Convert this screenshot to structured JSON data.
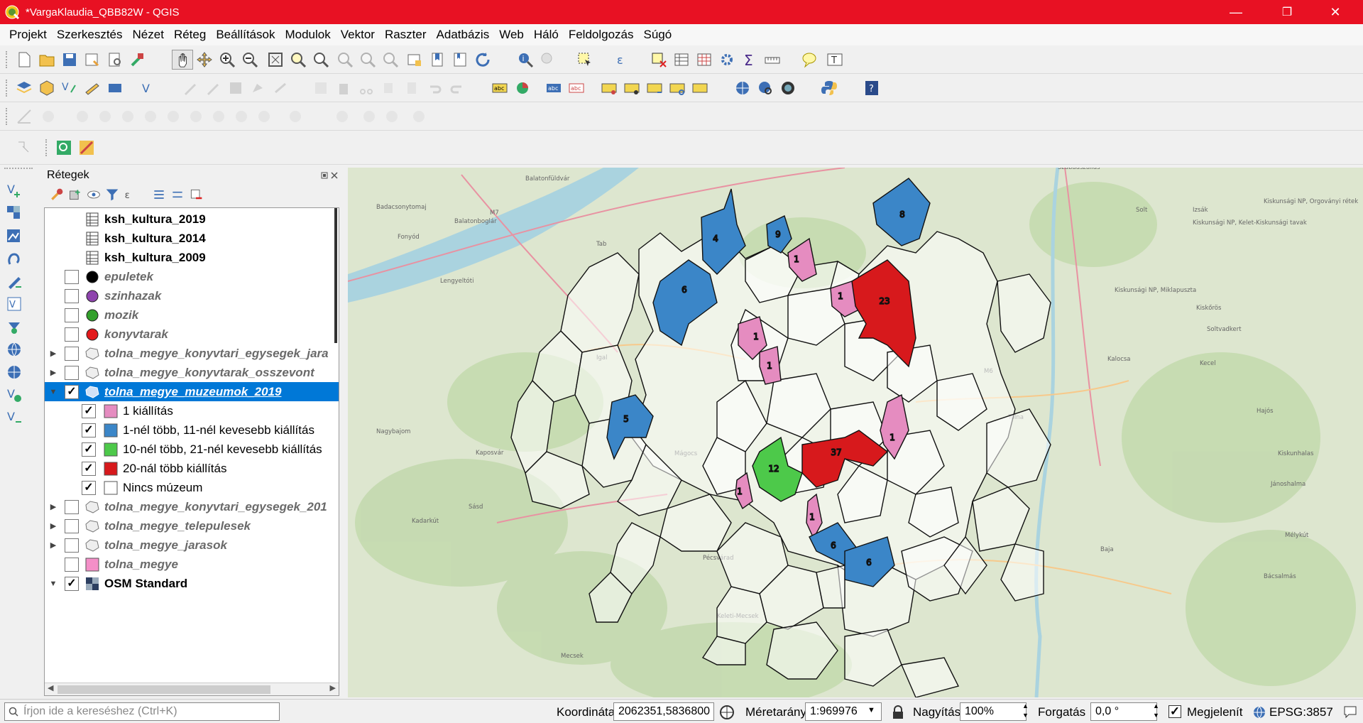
{
  "window": {
    "title": "*VargaKlaudia_QBB82W - QGIS",
    "minimize": "—",
    "maximize": "❐",
    "close": "✕"
  },
  "menu": [
    "Projekt",
    "Szerkesztés",
    "Nézet",
    "Réteg",
    "Beállítások",
    "Modulok",
    "Vektor",
    "Raszter",
    "Adatbázis",
    "Web",
    "Háló",
    "Feldolgozás",
    "Súgó"
  ],
  "layers_panel": {
    "title": "Rétegek",
    "items": [
      {
        "label": "ksh_kultura_2019",
        "type": "table",
        "checked": null,
        "style": "bold"
      },
      {
        "label": "ksh_kultura_2014",
        "type": "table",
        "checked": null,
        "style": "bold"
      },
      {
        "label": "ksh_kultura_2009",
        "type": "table",
        "checked": null,
        "style": "bold"
      },
      {
        "label": "epuletek",
        "type": "point",
        "color": "#000000",
        "checked": false,
        "style": "italic"
      },
      {
        "label": "szinhazak",
        "type": "point",
        "color": "#8e44ad",
        "checked": false,
        "style": "italic"
      },
      {
        "label": "mozik",
        "type": "point",
        "color": "#33a02c",
        "checked": false,
        "style": "italic"
      },
      {
        "label": "konyvtarak",
        "type": "point",
        "color": "#e31a1c",
        "checked": false,
        "style": "italic"
      },
      {
        "label": "tolna_megye_konyvtari_egysegek_jara",
        "type": "polygon",
        "checked": false,
        "style": "italic",
        "expandable": true
      },
      {
        "label": "tolna_megye_konyvtarak_osszevont",
        "type": "polygon",
        "checked": false,
        "style": "italic",
        "expandable": true
      },
      {
        "label": "tolna_megye_muzeumok_2019",
        "type": "polygon",
        "checked": true,
        "style": "selected",
        "expanded": true
      },
      {
        "label": "1 kiállítás",
        "type": "legend",
        "color": "#e58cc0",
        "checked": true
      },
      {
        "label": "1-nél több, 11-nél kevesebb kiállítás",
        "type": "legend",
        "color": "#3b86c8",
        "checked": true
      },
      {
        "label": "10-nél több, 21-nél kevesebb kiállítás",
        "type": "legend",
        "color": "#4dc94a",
        "checked": true
      },
      {
        "label": "20-nál több kiállítás",
        "type": "legend",
        "color": "#d7191c",
        "checked": true
      },
      {
        "label": "Nincs múzeum",
        "type": "legend",
        "color": "#ffffff",
        "checked": true
      },
      {
        "label": "tolna_megye_konyvtari_egysegek_201",
        "type": "polygon",
        "checked": false,
        "style": "italic",
        "expandable": true
      },
      {
        "label": "tolna_megye_telepulesek",
        "type": "polygon",
        "checked": false,
        "style": "italic",
        "expandable": true
      },
      {
        "label": "tolna_megye_jarasok",
        "type": "polygon",
        "checked": false,
        "style": "italic",
        "expandable": true
      },
      {
        "label": "tolna_megye",
        "type": "fill",
        "color": "#f48fc8",
        "checked": false,
        "style": "italic"
      },
      {
        "label": "OSM Standard",
        "type": "raster",
        "checked": true,
        "style": "bold",
        "expanded": true
      }
    ]
  },
  "map": {
    "places": [
      "Badacsonytomaj",
      "Balatonfüldvár",
      "Balatonboglár",
      "Fonyód",
      "Tab",
      "Lengyeltóti",
      "Igal",
      "Nagybajom",
      "Kaposvár",
      "Kadarkút",
      "Sásd",
      "Pécsvárad",
      "Mecsek",
      "Keleti-Mecsek",
      "Szabadszállás",
      "Solt",
      "Izsák",
      "Kiskunsági NP, Orgoványi rétek",
      "Kiskunsági NP, Kelet-Kiskunsági tavak",
      "Kiskunsági NP, Miklapuszta",
      "Kiskőrös",
      "Soltvadkert",
      "Kalocsa",
      "Kecel",
      "Tolna",
      "Hajós",
      "Kiskunhalas",
      "Jánoshalma",
      "Mélykút",
      "Bácsalmás",
      "Baja",
      "Mágocs",
      "M7",
      "M6"
    ],
    "region_values": [
      "4",
      "9",
      "8",
      "1",
      "6",
      "1",
      "23",
      "1",
      "1",
      "5",
      "1",
      "37",
      "12",
      "1",
      "1",
      "6",
      "6"
    ]
  },
  "status": {
    "search_placeholder": "Írjon ide a kereséshez (Ctrl+K)",
    "coord_label": "Koordináta",
    "coord_value": "2062351,5836800",
    "scale_label": "Méretarány",
    "scale_value": "1:969976",
    "zoom_label": "Nagyítás",
    "zoom_value": "100%",
    "rotation_label": "Forgatás",
    "rotation_value": "0,0 °",
    "render_label": "Megjelenít",
    "crs": "EPSG:3857"
  }
}
